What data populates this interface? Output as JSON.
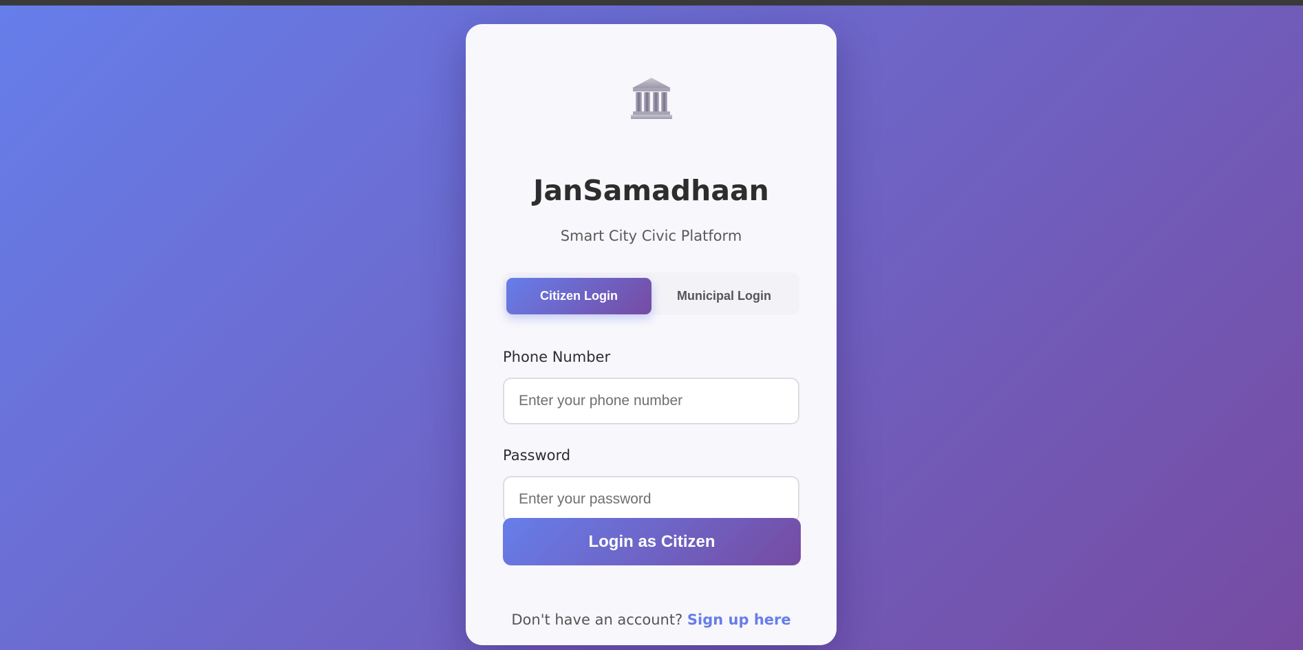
{
  "app": {
    "title": "JanSamadhaan",
    "subtitle": "Smart City Civic Platform",
    "logo_icon": "government-building-icon"
  },
  "tabs": [
    {
      "label": "Citizen Login",
      "active": true
    },
    {
      "label": "Municipal Login",
      "active": false
    }
  ],
  "form": {
    "phone": {
      "label": "Phone Number",
      "placeholder": "Enter your phone number",
      "value": ""
    },
    "password": {
      "label": "Password",
      "placeholder": "Enter your password",
      "value": ""
    },
    "submit_label": "Login as Citizen"
  },
  "footer": {
    "text": "Don't have an account?",
    "link_label": "Sign up here"
  },
  "colors": {
    "gradient_start": "#667eea",
    "gradient_end": "#764ba2",
    "card_background": "#f8f7fb",
    "link": "#667eea"
  }
}
